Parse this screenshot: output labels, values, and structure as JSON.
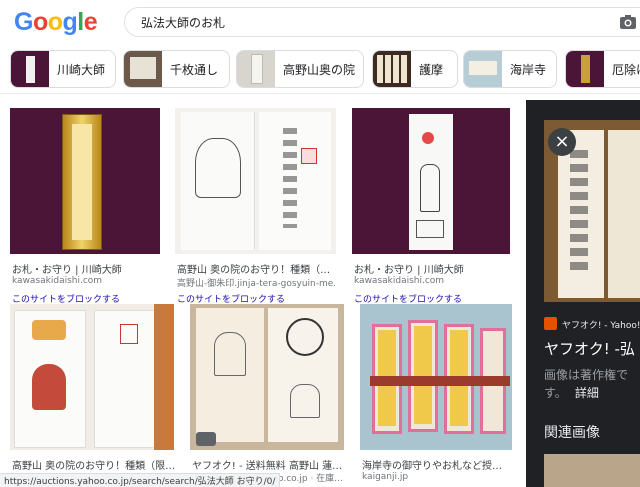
{
  "search": {
    "query": "弘法大師のお札"
  },
  "chips": [
    {
      "label": "川崎大師"
    },
    {
      "label": "千枚通し"
    },
    {
      "label": "高野山奥の院"
    },
    {
      "label": "護摩"
    },
    {
      "label": "海岸寺"
    },
    {
      "label": "厄除け"
    }
  ],
  "results": [
    {
      "caption": "お札・お守り | 川崎大師",
      "source": "kawasakidaishi.com",
      "block": "このサイトをブロックする"
    },
    {
      "caption": "高野山 奥の院のお守り！種類（…",
      "source": "高野山-御朱印.jinja-tera-gosyuin-me…",
      "block": "このサイトをブロックする"
    },
    {
      "caption": "お札・お守り | 川崎大師",
      "source": "kawasakidaishi.com",
      "block": "このサイトをブロックする"
    },
    {
      "caption": "高野山 奥の院のお守り！種類（限…",
      "source": "",
      "block": ""
    },
    {
      "caption": "ヤフオク! - 送料無料 高野山 蓮…",
      "source": "o.co.jp · 在庫…",
      "block": ""
    },
    {
      "caption": "海岸寺の御守りやお札など授…",
      "source": "kaiganji.jp",
      "block": ""
    }
  ],
  "panel": {
    "close_icon": "×",
    "source": "ヤフオク! - Yahoo!",
    "title": "ヤフオク! -弘",
    "note_line1": "画像は著作権で",
    "note_line2_a": "す。",
    "note_line2_b": "詳細",
    "related": "関連画像"
  },
  "status_url": "https://auctions.yahoo.co.jp/search/search/弘法大師 お守り/0/",
  "colors": {
    "link": "#1a0dab",
    "panel_bg": "#202124",
    "purple_cloth": "#4a1536"
  }
}
